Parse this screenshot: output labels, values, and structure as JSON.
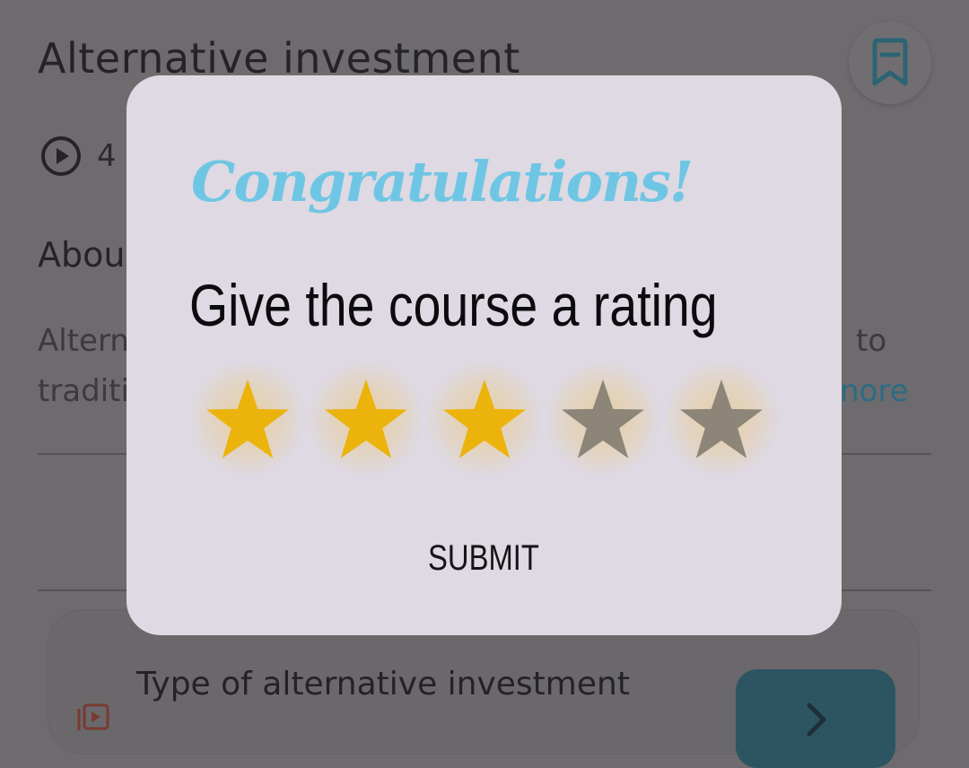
{
  "course": {
    "title": "Alternative investment",
    "lesson_count": "4",
    "about_heading": "Abou",
    "about_line1_start": "Altern",
    "about_line1_end": "to",
    "about_line2_start": "traditi",
    "read_more": "nore"
  },
  "lesson": {
    "title": "Type of alternative investment"
  },
  "dialog": {
    "heading": "Congratulations!",
    "prompt": "Give the course a rating",
    "rating": {
      "value": 3,
      "max": 5
    },
    "submit_label": "SUBMIT"
  },
  "colors": {
    "star_filled": "#ebb30c",
    "star_empty": "#8c8578",
    "heading_accent": "#6ec6e4",
    "dialog_bg": "#ded9e2"
  },
  "icons": [
    "bookmark-icon",
    "play-circle-icon",
    "video-lesson-icon",
    "chevron-right-icon",
    "star-icon"
  ]
}
